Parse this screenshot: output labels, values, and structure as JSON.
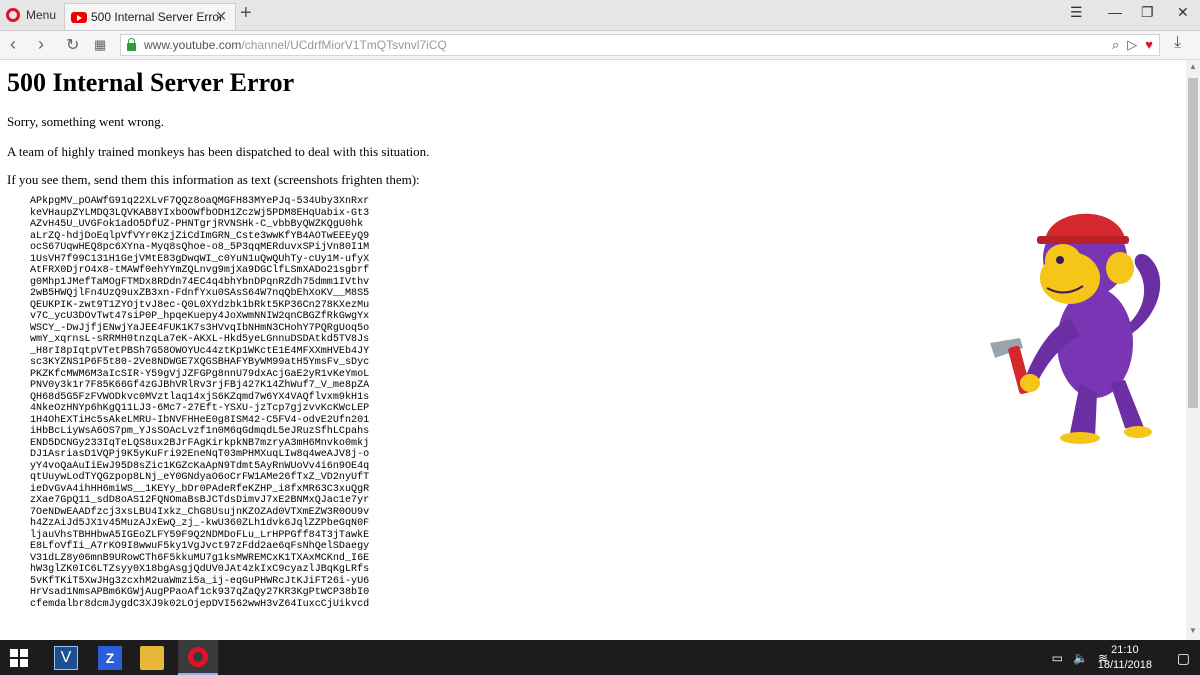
{
  "browser": {
    "menu_label": "Menu",
    "tab_title": "500 Internal Server Error",
    "tab_close": "✕",
    "new_tab": "+",
    "url_domain": "www.youtube.com",
    "url_path": "/channel/UCdrfMiorV1TmQTsvnvl7iCQ"
  },
  "page": {
    "title": "500 Internal Server Error",
    "line1": "Sorry, something went wrong.",
    "line2": "A team of highly trained monkeys has been dispatched to deal with this situation.",
    "line3": "If you see them, send them this information as text (screenshots frighten them):",
    "debug_text": "APkpgMV_pOAWfG91q22XLvF7QQz8oaQMGFH83MYePJq-534Uby3XnRxr\nkeVHaupZYLMDQ3LQVKAB8YIxbOOWfbODH1ZczWj5PDM8EHqUabix-Gt3\nAZvH45U_UVGFok1adO5DfUZ-PHNTgrjRVNSHk-C_vbbByQWZKQgU0hk\naLrZQ-hdjDoEqlpVfVYr0KzjZiCdImGRN_Cste3wwKfYB4AOTwEEEyQ9\nocS67UqwHEQ8pc6XYna-Myq8sQhoe-o8_5P3qqMERduvxSPijVn80I1M\n1UsVH7f99C131H1GejVMtE83gDwqWI_c0YuN1uQwQUhTy-cUy1M-ufyX\nAtFRX0DjrO4x8-tMAWf0ehYYmZQLnvg9mjXa9DGClfLSmXADo21sgbrf\ng0Mhp1JMefTaMOgFTMDx8RDdn74EC4q4bhYbnDPqnRZdh75dmm1IVthv\n2wB5HWQjlFn4UzQ9uxZB3xn-FdnfYxu0SAsS64W7nqQbEhXoKV__M8S5\nQEUKPIK-zwt9T1ZYOjtvJ8ec-Q0L0XYdzbk1bRkt5KP36Cn278KXezMu\nv7C_ycU3DOvTwt47siP0P_hpqeKuepy4JoXwmNNIW2qnCBGZfRkGwgYx\nWSCY_-DwJjfjENwjYaJEE4FUK1K7s3HVvqIbNHmN3CHohY7PQRgUoq5o\nwmY_xqrnsL-sRRMH0tnzqLa7eK-AKXL-Hkd5yeLGnnuDSDAtkd5TV8Js\n_H8rI8pIqtpVTetPBSh7G58OWOYUc44ztKp1WKctE1E4MFXXmHVEb4JY\nsc3KYZNS1P6F5t80-2Ve8NDWGE7XQGSBHAFYByWM99atH5YmsFv_sDyc\nPKZKfcMWM6M3aIcSIR-Y59gVjJZFGPg8nnU79dxAcjGaE2yR1vKeYmoL\nPNV0y3k1r7F85K66Gf4zGJBhVRlRv3rjFBj427K14ZhWuf7_V_me8pZA\nQH68d5G5FzFVWODkvc0MVztlaq14xjS6KZqmd7w6YX4VAQflvxm9kH1s\n4NkeOzHNYp6hKgQ11LJ3-6Mc7-27Eft-YSXU-jzTcp7gjzvvKcKWcLEP\n1H4OhEXTiHc5sAkeLMRU-IbNVFHHeE0g8ISM42-C5FV4-odvE2Ufn201\niHbBcLiyWsA6OS7pm_YJsSOAcLvzf1n0M6qGdmqdL5eJRuzSfhLCpahs\nEND5DCNGy233IqTeLQS8ux2BJrFAgKirkpkNB7mzryA3mH6Mnvko0mkj\nDJ1AsriasD1VQPj9K5yKuFri92EneNqT03mPHMXuqLIw8q4weAJV8j-o\nyY4voQaAuIiEwJ95D8sZic1KGZcKaApN9Tdmt5AyRnWUoVv4i6n9OE4q\nqtUuywLodTYQGzpop8LNj_eY0GNdyaO6oCrFW1AMe26fTxZ_VD2nyUfT\nieDvGvA4ihHH6miWS__1KEYy_bDr0PAdeRfeKZHP_i8fxMR63C3xuQgR\nzXae7GpQ11_sdD8oAS12FQNOmaBsBJCTdsDimvJ7xE2BNMxQJac1e7yr\n7OeNDwEAADfzcj3xsLBU4Ixkz_ChG8UsujnKZOZAd0VTXmEZW3R0OU9v\nh4ZzAiJd5JX1v45MuzAJxEwQ_zj_-kwU360ZLh1dvk6JqlZZPbeGqN0F\nljauVhsTBHHbwA5IGEoZLFY59F9Q2NDMDoFLu_LrHPPGff84T3jTawkE\nE8LfoVfIi_A7rKO9I8wwuF5ky1VgJvct97zFdd2ae6qFsNhQelSDaegy\nV31dLZ8y06mnB9URowCTh6F5kkuMU7g1ksMWREMCxK1TXAxMCKnd_I6E\nhW3glZK0IC6LTZsyy0X18bgAsgjQdUV0JAt4zkIxC9cyazlJBqKgLRfs\n5vKfTKiT5XwJHg3zcxhM2uaWmzi5a_ij-eqGuPHWRcJtKJiFT26i-yU6\nHrVsad1NmsAPBm6KGWjAugPPaoAf1ck937qZaQy27KR3KgPtWCP38bI0\ncfemdalbr8dcmJygdC3XJ9k02LOjepDVI562wwH3vZ64IuxcCjUikvcd"
  },
  "taskbar": {
    "time": "21:10",
    "date": "18/11/2018"
  },
  "colors": {
    "opera_red": "#e0112b",
    "secure_green": "#2e9e3a",
    "monkey_purple": "#6b2fa3",
    "monkey_face": "#f5c518",
    "helmet_red": "#d6262e"
  }
}
